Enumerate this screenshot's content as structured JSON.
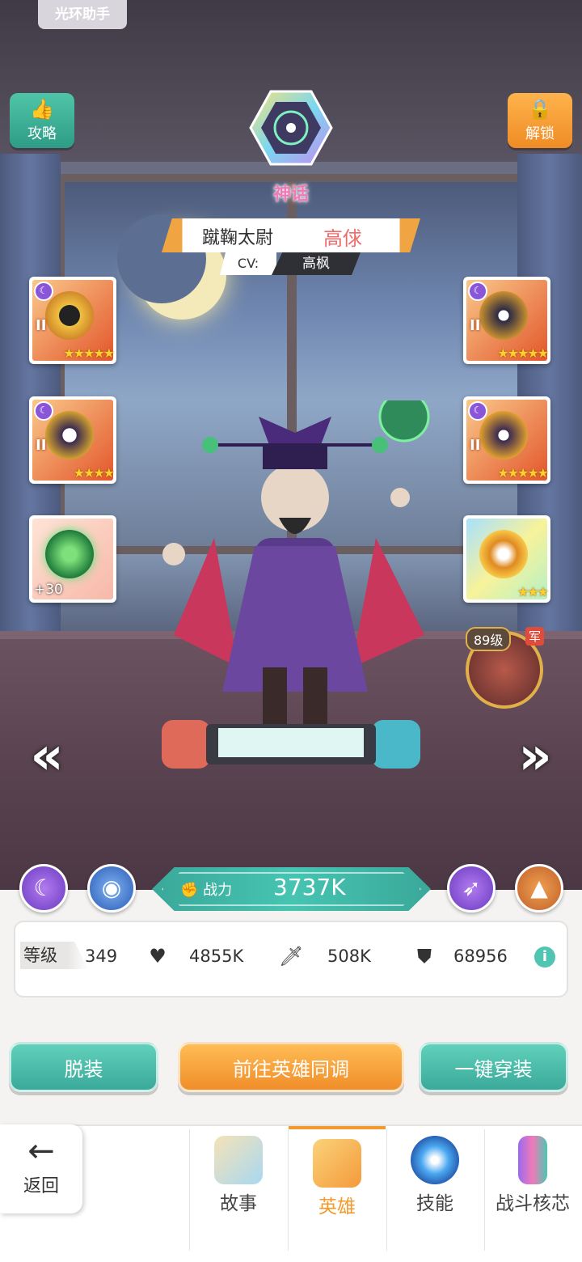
{
  "top_tag": "光环助手",
  "corner_buttons": {
    "guide_label": "攻略",
    "unlock_label": "解锁"
  },
  "hero": {
    "rarity": "神话",
    "title": "蹴鞠太尉",
    "name": "高俅",
    "cv_label": "CV:",
    "cv_name": "高枫"
  },
  "equipment": {
    "left": [
      {
        "tier": "II",
        "stars": "★★★★★"
      },
      {
        "tier": "II",
        "stars": "★★★★"
      },
      {
        "plus": "+30"
      }
    ],
    "right": [
      {
        "tier": "II",
        "stars": "★★★★★"
      },
      {
        "tier": "II",
        "stars": "★★★★★"
      },
      {
        "stars": "★★★"
      }
    ]
  },
  "companion": {
    "level": "89级",
    "faction": "军"
  },
  "power": {
    "label": "战力",
    "value": "3737K"
  },
  "stats": {
    "level_label": "等级",
    "level_value": "349",
    "hp": "4855K",
    "attack": "508K",
    "defense": "68956"
  },
  "actions": {
    "unequip": "脱装",
    "sync": "前往英雄同调",
    "equip_all": "一键穿装"
  },
  "nav": {
    "back": "返回",
    "tabs": [
      "故事",
      "英雄",
      "技能",
      "战斗核芯"
    ],
    "active_tab": "英雄"
  },
  "colors": {
    "accent_teal": "#3aa99a",
    "accent_orange": "#f08e2a",
    "rarity_pink": "#f07ab8",
    "hero_name_red": "#f06a6a"
  }
}
